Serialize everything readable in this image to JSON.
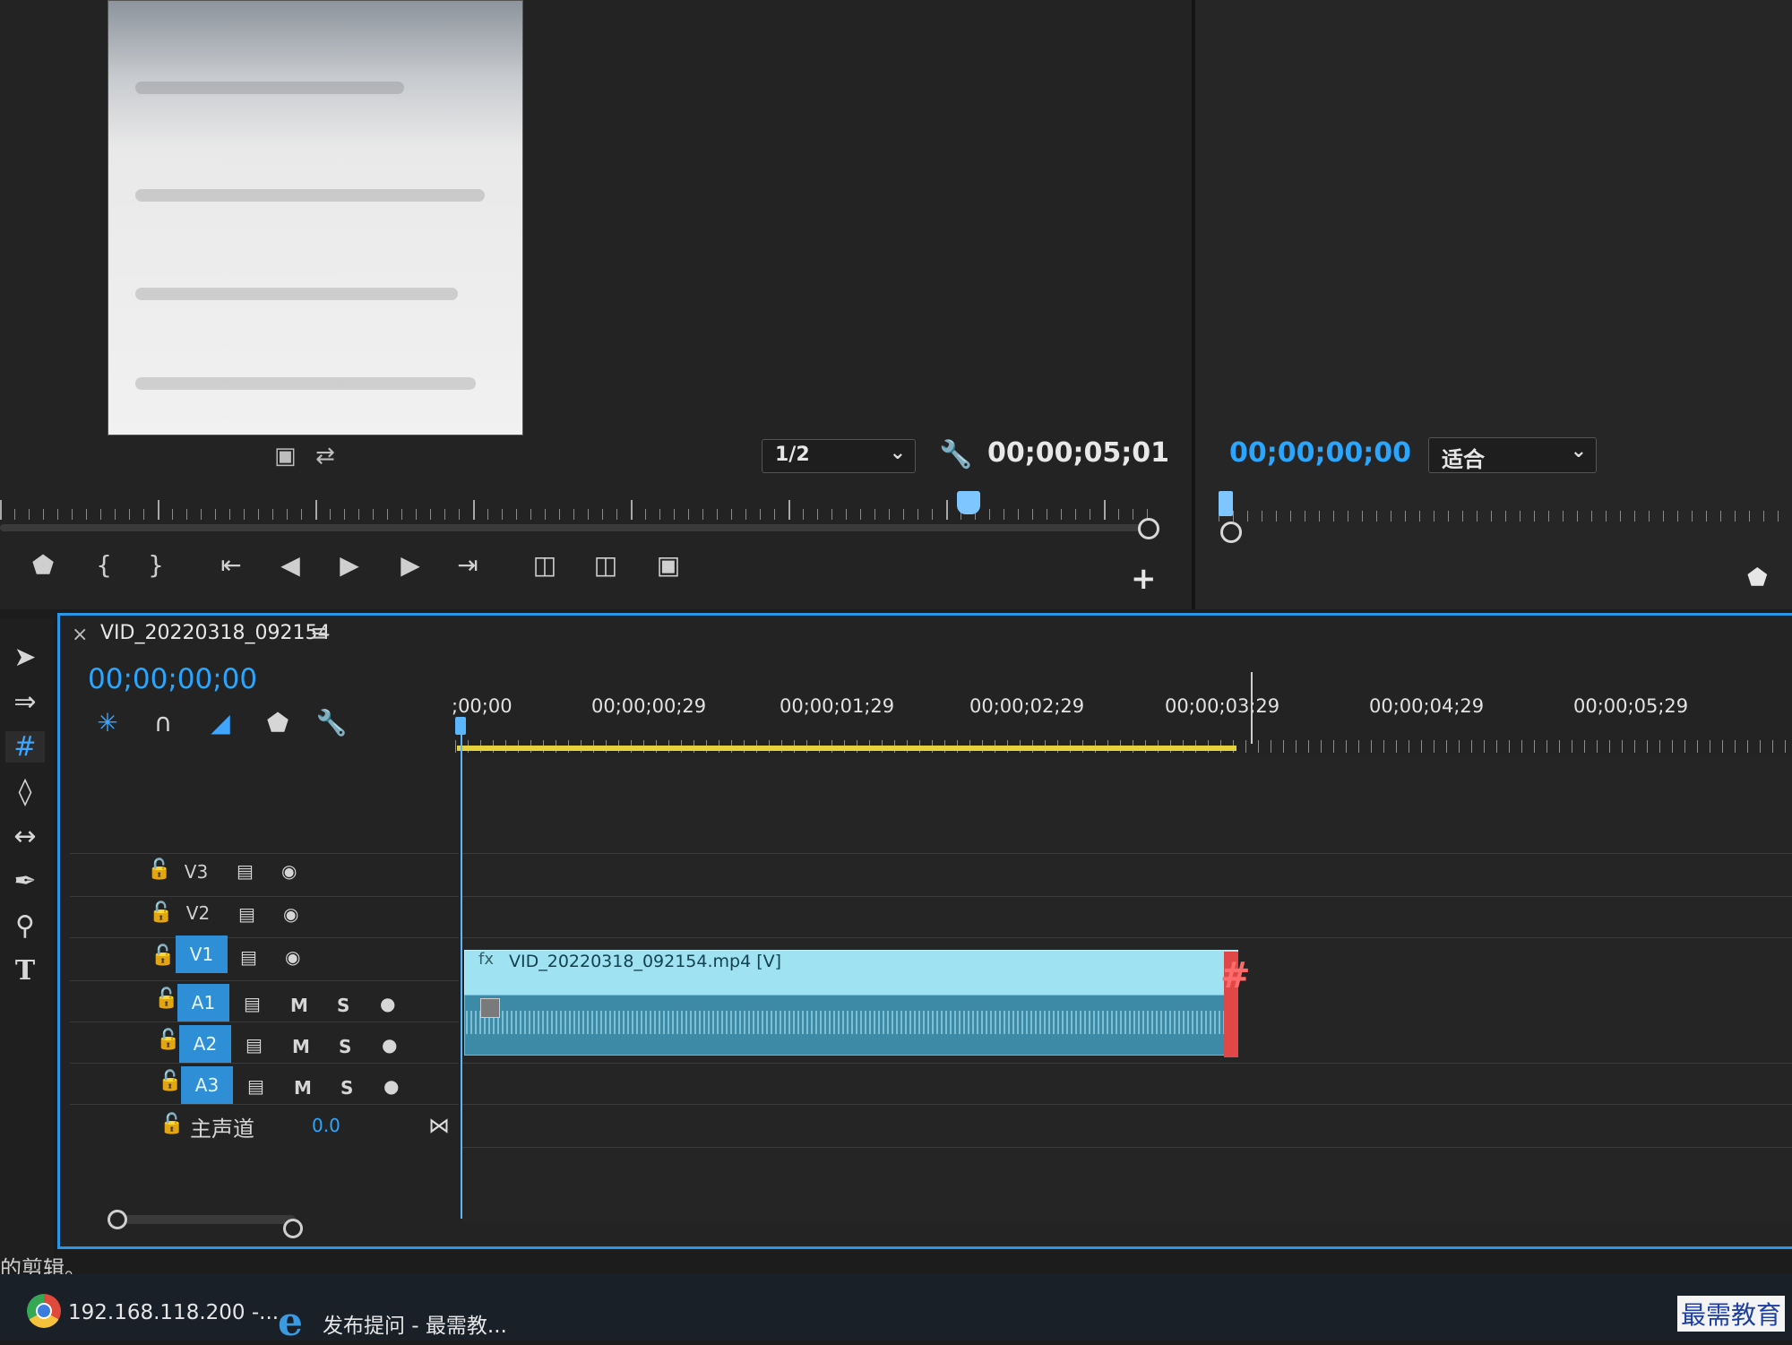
{
  "source_monitor": {
    "zoom": "1/2",
    "timecode": "00;00;05;01"
  },
  "program_monitor": {
    "timecode": "00;00;00;00",
    "fit": "适合"
  },
  "timeline": {
    "sequence_name": "VID_20220318_092154",
    "timecode": "00;00;00;00",
    "ruler_labels": [
      ";00;00",
      "00;00;00;29",
      "00;00;01;29",
      "00;00;02;29",
      "00;00;03;29",
      "00;00;04;29",
      "00;00;05;29"
    ],
    "video_tracks": [
      {
        "name": "V3",
        "targeted": false
      },
      {
        "name": "V2",
        "targeted": false
      },
      {
        "name": "V1",
        "targeted": true
      }
    ],
    "audio_tracks": [
      {
        "name": "A1",
        "mute": "M",
        "solo": "S",
        "targeted": true
      },
      {
        "name": "A2",
        "mute": "M",
        "solo": "S",
        "targeted": true
      },
      {
        "name": "A3",
        "mute": "M",
        "solo": "S",
        "targeted": true
      }
    ],
    "master": {
      "label": "主声道",
      "value": "0.0"
    },
    "video_clip": {
      "label": "VID_20220318_092154.mp4 [V]",
      "fx": "fx"
    }
  },
  "status": {
    "caption": "的剪辑。"
  },
  "taskbar": {
    "chrome_label": "192.168.118.200 -...",
    "ie_label": "发布提问 - 最需教..."
  },
  "watermark": "最需教育",
  "colors": {
    "accent": "#2aa6ff",
    "clip_video": "#9fe3f2",
    "clip_audio": "#3c8aa6",
    "work_area": "#e6d23c",
    "panel_focus": "#2b96e8"
  }
}
